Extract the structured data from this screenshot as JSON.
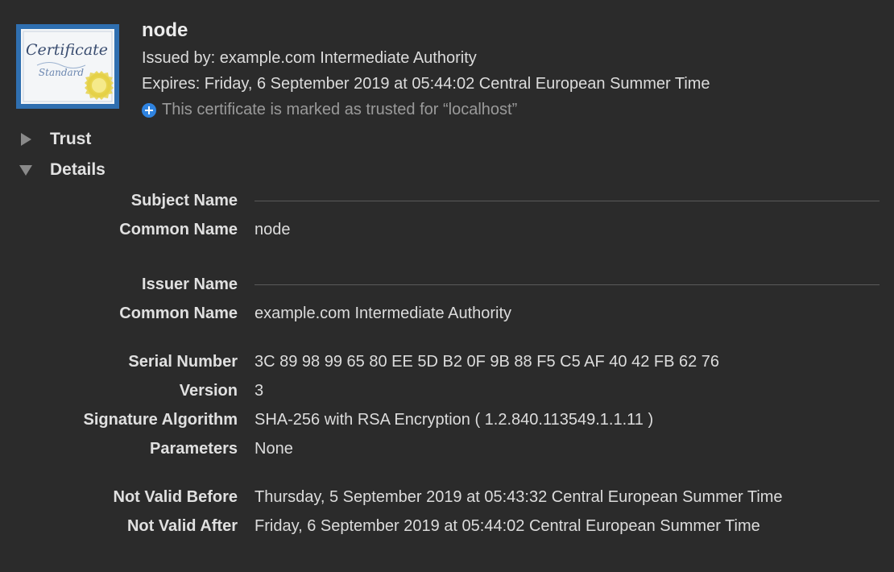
{
  "header": {
    "name": "node",
    "issued_by": "Issued by: example.com Intermediate Authority",
    "expires": "Expires: Friday, 6 September 2019 at 05:44:02 Central European Summer Time",
    "trust_note": "This certificate is marked as trusted for “localhost”",
    "icon": "certificate-standard-icon",
    "icon_text": {
      "title": "Certificate",
      "subtitle": "Standard"
    }
  },
  "sections": {
    "trust": {
      "label": "Trust",
      "expanded": false
    },
    "details": {
      "label": "Details",
      "expanded": true
    }
  },
  "details": {
    "subject_heading": "Subject Name",
    "subject_common_name_label": "Common Name",
    "subject_common_name": "node",
    "issuer_heading": "Issuer Name",
    "issuer_common_name_label": "Common Name",
    "issuer_common_name": "example.com Intermediate Authority",
    "serial_label": "Serial Number",
    "serial": "3C 89 98 99 65 80 EE 5D B2 0F 9B 88 F5 C5 AF 40 42 FB 62 76",
    "version_label": "Version",
    "version": "3",
    "sigalg_label": "Signature Algorithm",
    "sigalg": "SHA-256 with RSA Encryption ( 1.2.840.113549.1.1.11 )",
    "params_label": "Parameters",
    "params": "None",
    "not_before_label": "Not Valid Before",
    "not_before": "Thursday, 5 September 2019 at 05:43:32 Central European Summer Time",
    "not_after_label": "Not Valid After",
    "not_after": "Friday, 6 September 2019 at 05:44:02 Central European Summer Time"
  },
  "colors": {
    "background": "#2b2b2b",
    "accent_blue": "#2f83e0",
    "icon_frame": "#2f6fb0",
    "seal_gold": "#e6d24a"
  }
}
